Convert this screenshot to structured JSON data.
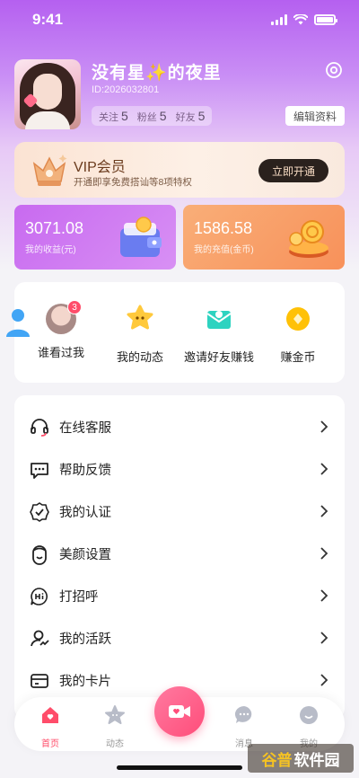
{
  "status_bar": {
    "time": "9:41"
  },
  "profile": {
    "name": "没有星✨的夜里",
    "id_text": "ID:2026032801",
    "stats": [
      {
        "label": "关注",
        "value": "5"
      },
      {
        "label": "粉丝",
        "value": "5"
      },
      {
        "label": "好友",
        "value": "5"
      }
    ],
    "edit_label": "编辑资料"
  },
  "vip": {
    "title": "VIP会员",
    "subtitle": "开通即享免费搭讪等8项特权",
    "button_label": "立即开通"
  },
  "wallet": {
    "earnings": {
      "amount": "3071.08",
      "label": "我的收益(元)"
    },
    "recharge": {
      "amount": "1586.58",
      "label": "我的充值(金币)"
    }
  },
  "quick_actions": [
    {
      "label": "谁看过我",
      "badge": "3",
      "icon": "visitor-avatar-icon"
    },
    {
      "label": "我的动态",
      "icon": "star-face-icon"
    },
    {
      "label": "邀请好友赚钱",
      "icon": "envelope-icon"
    },
    {
      "label": "赚金币",
      "icon": "coin-icon"
    }
  ],
  "menu": [
    {
      "label": "在线客服",
      "icon": "headset-icon"
    },
    {
      "label": "帮助反馈",
      "icon": "chat-bubble-icon"
    },
    {
      "label": "我的认证",
      "icon": "verified-badge-icon"
    },
    {
      "label": "美颜设置",
      "icon": "face-beauty-icon"
    },
    {
      "label": "打招呼",
      "icon": "hi-bubble-icon"
    },
    {
      "label": "我的活跃",
      "icon": "activity-icon"
    },
    {
      "label": "我的卡片",
      "icon": "card-icon"
    }
  ],
  "tabbar": [
    {
      "label": "首页",
      "icon": "home-icon",
      "active": true
    },
    {
      "label": "动态",
      "icon": "star-icon"
    },
    {
      "label": "",
      "icon": "video-call-icon"
    },
    {
      "label": "消息",
      "icon": "message-icon"
    },
    {
      "label": "我的",
      "icon": "profile-icon"
    }
  ],
  "watermark": {
    "part1": "谷普",
    "part2": "软件园"
  },
  "colors": {
    "accent_pink": "#ff4d6a",
    "purple": "#c86af0",
    "orange": "#f8915a",
    "vip_dark": "#2a211d"
  }
}
